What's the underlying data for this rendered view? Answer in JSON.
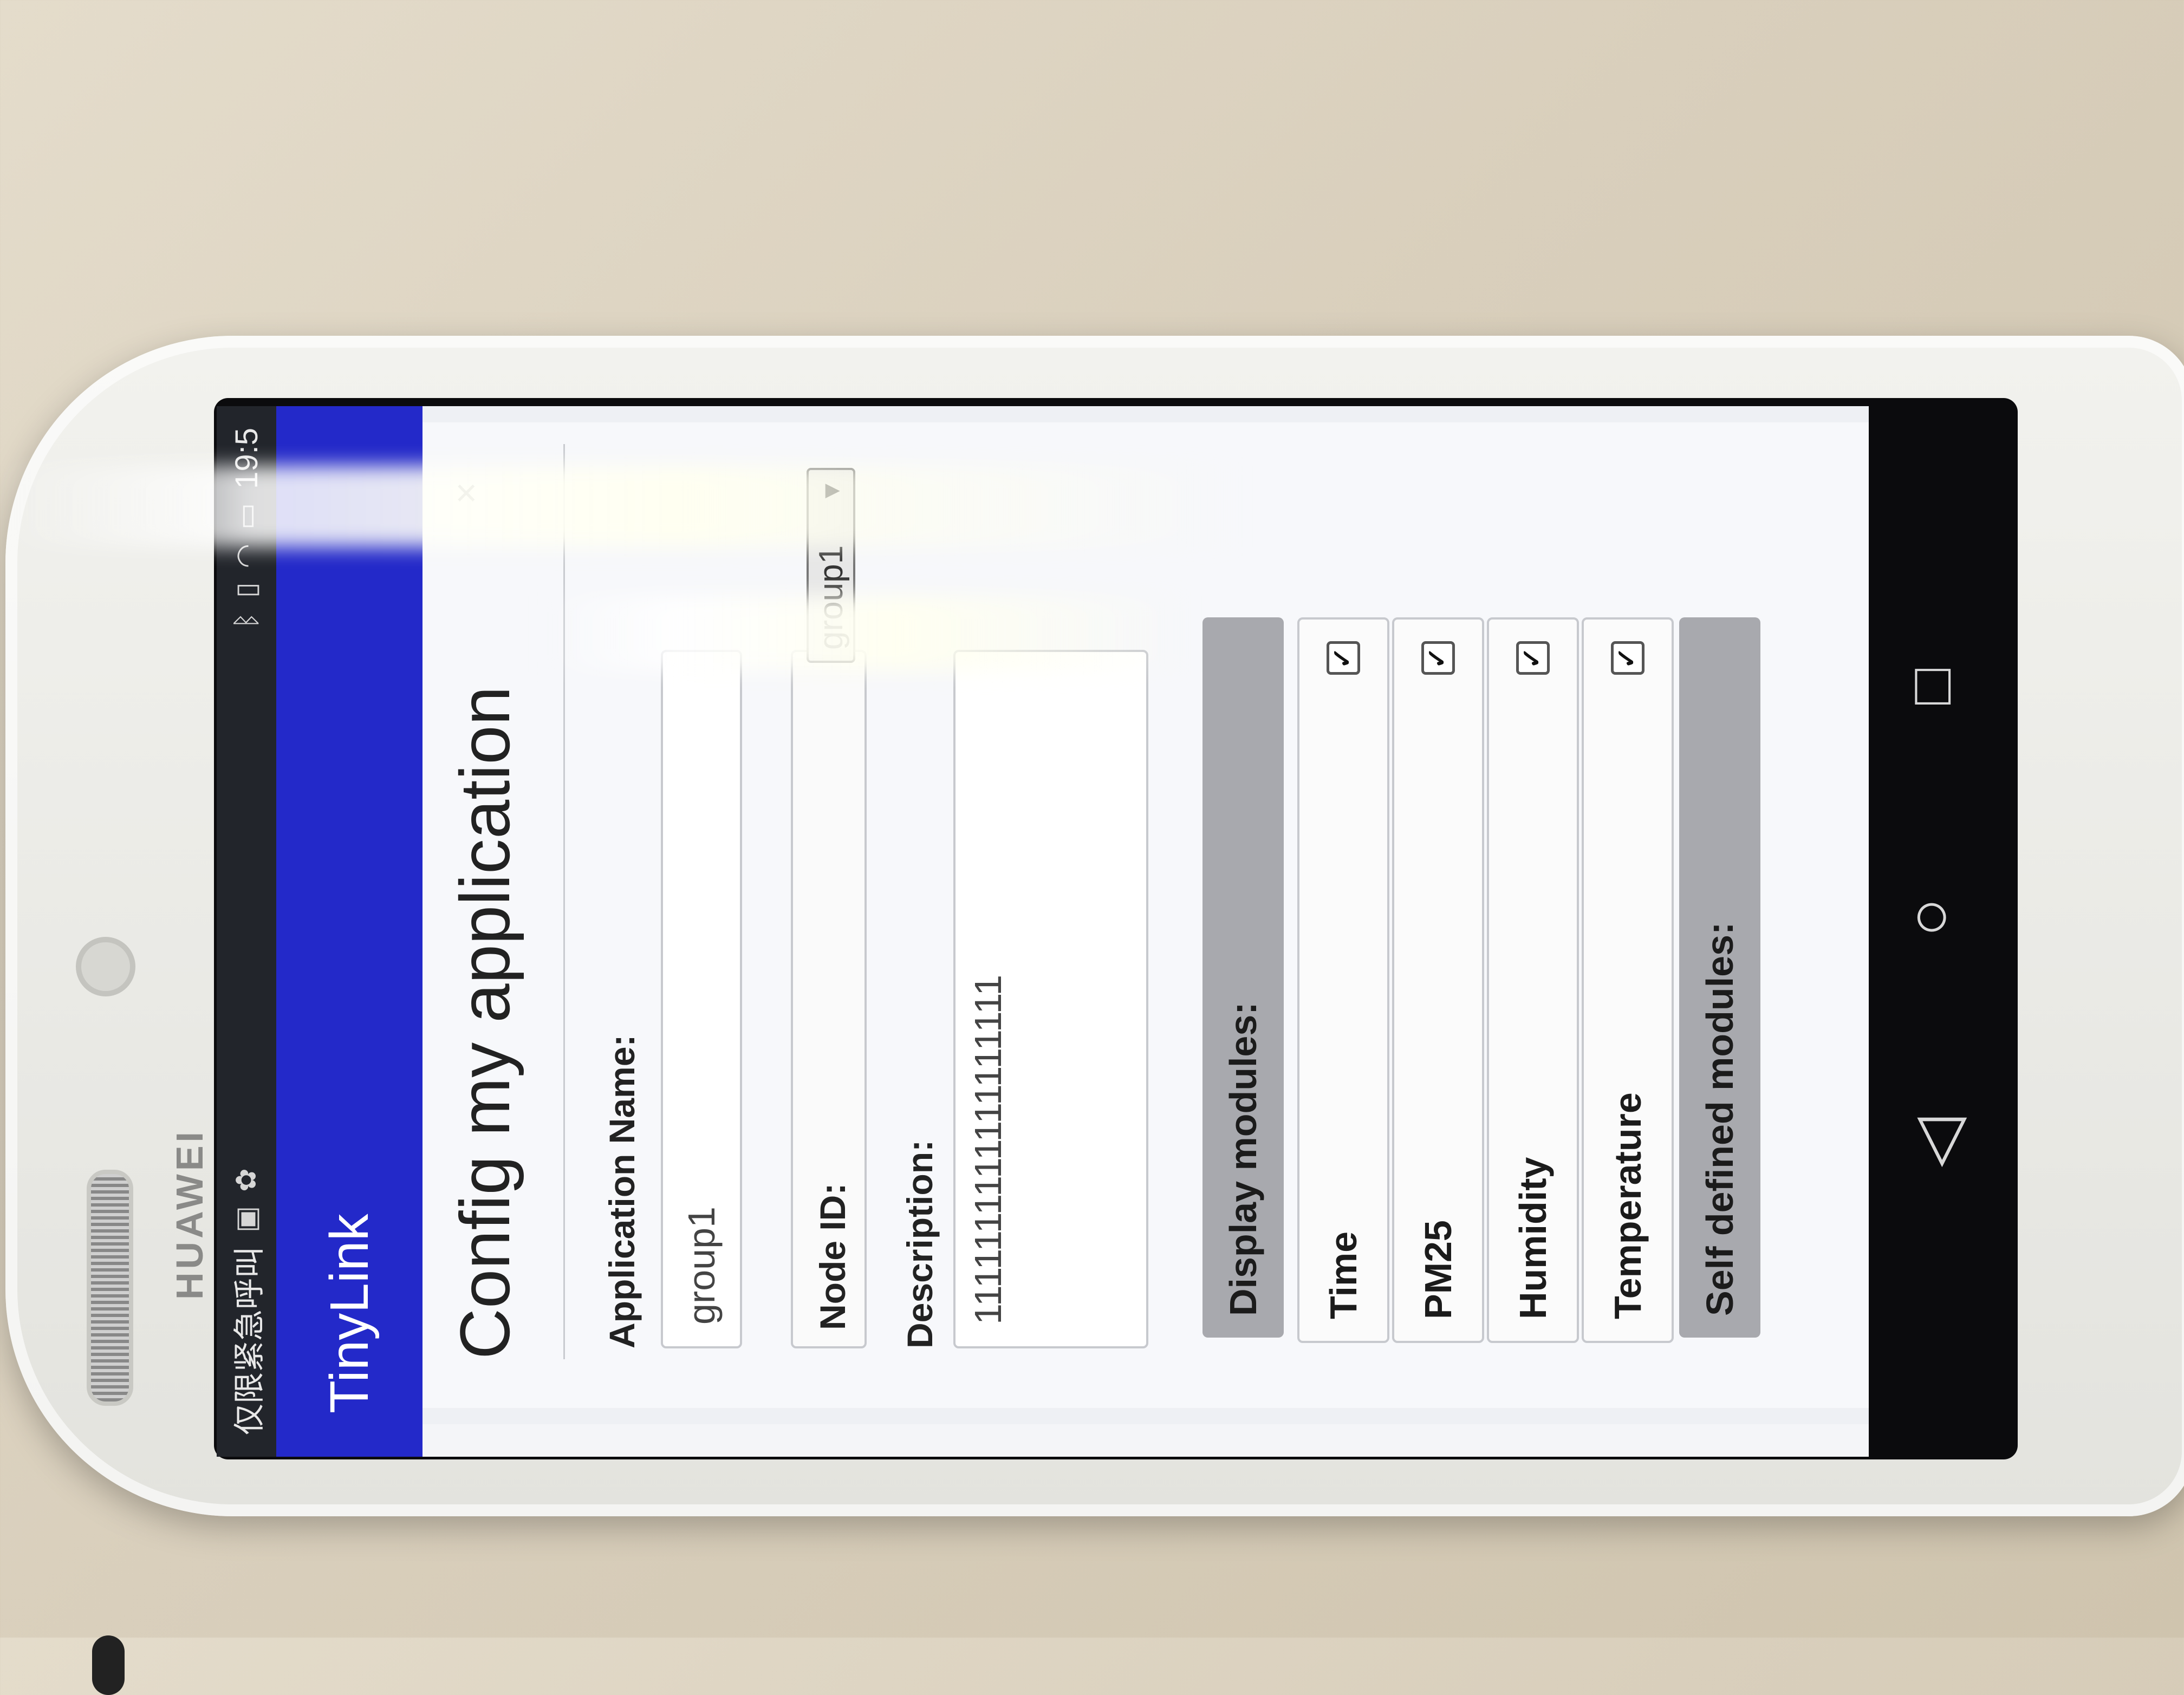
{
  "device": {
    "brand": "HUAWEI"
  },
  "status_bar": {
    "left_text": "仅限紧急呼叫",
    "time": "19:5",
    "icons": [
      "sim-icon",
      "bluetooth-icon",
      "vibrate-icon",
      "wifi-icon",
      "battery-icon"
    ]
  },
  "app_bar": {
    "title": "TinyLink"
  },
  "dialog": {
    "title": "Config my application",
    "close_symbol": "×",
    "app_name": {
      "label": "Application Name:",
      "value": "group1"
    },
    "node_id": {
      "label": "Node ID:",
      "selected": "group1"
    },
    "description": {
      "label": "Description:",
      "value": "1111111111111111111"
    },
    "display_modules": {
      "header": "Display modules:",
      "items": [
        {
          "label": "Time",
          "checked": true
        },
        {
          "label": "PM25",
          "checked": true
        },
        {
          "label": "Humidity",
          "checked": true
        },
        {
          "label": "Temperature",
          "checked": true
        }
      ]
    },
    "self_defined_modules": {
      "header": "Self defined modules:"
    }
  },
  "nav_bar": {
    "icons": [
      "back-icon",
      "home-icon",
      "recents-icon"
    ]
  }
}
